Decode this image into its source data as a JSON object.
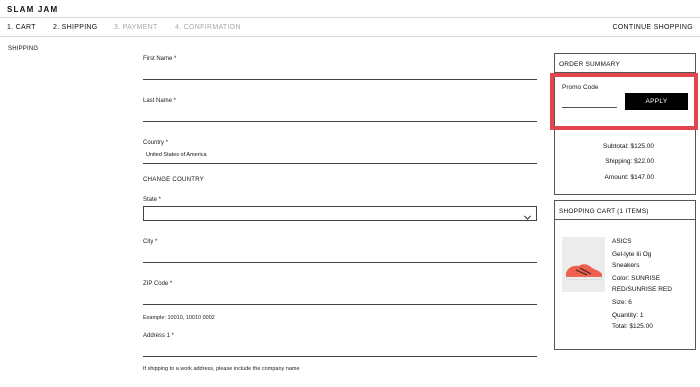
{
  "brand": {
    "logo": "SLAM JAM"
  },
  "steps": [
    {
      "label": "1. CART",
      "state": "done"
    },
    {
      "label": "2. SHIPPING",
      "state": "done"
    },
    {
      "label": "3. PAYMENT",
      "state": "todo"
    },
    {
      "label": "4. CONFIRMATION",
      "state": "todo"
    }
  ],
  "continue_label": "CONTINUE SHOPPING",
  "section_label": "SHIPPING",
  "form": {
    "first_name_label": "First Name *",
    "last_name_label": "Last Name *",
    "country_label": "Country *",
    "country_value": "United States of America",
    "change_country": "CHANGE COUNTRY",
    "state_label": "State *",
    "city_label": "City *",
    "zip_label": "ZIP Code *",
    "zip_example": "Example: 10010, 10010 0002",
    "address1_label": "Address 1 *",
    "address_hint": "If shipping to a work address, please include the company name"
  },
  "order_summary": {
    "title": "ORDER SUMMARY",
    "promo_label": "Promo Code",
    "promo_value": "",
    "apply_label": "APPLY",
    "subtotal": "Subtotal: $125.00",
    "shipping": "Shipping: $22.00",
    "amount": "Amount: $147.00"
  },
  "cart": {
    "title": "SHOPPING CART (1 ITEMS)",
    "brand": "ASICS",
    "name_line1": "Gel-lyte Iii Og",
    "name_line2": "Sneakers",
    "color_line1": "Color: SUNRISE",
    "color_line2": "RED/SUNRISE RED",
    "size": "Size: 6",
    "quantity": "Quantity: 1",
    "total": "Total: $125.00"
  },
  "colors": {
    "highlight": "#e1454d",
    "shoe": "#ef5f4c",
    "disabled_step": "#a8a8a8"
  }
}
